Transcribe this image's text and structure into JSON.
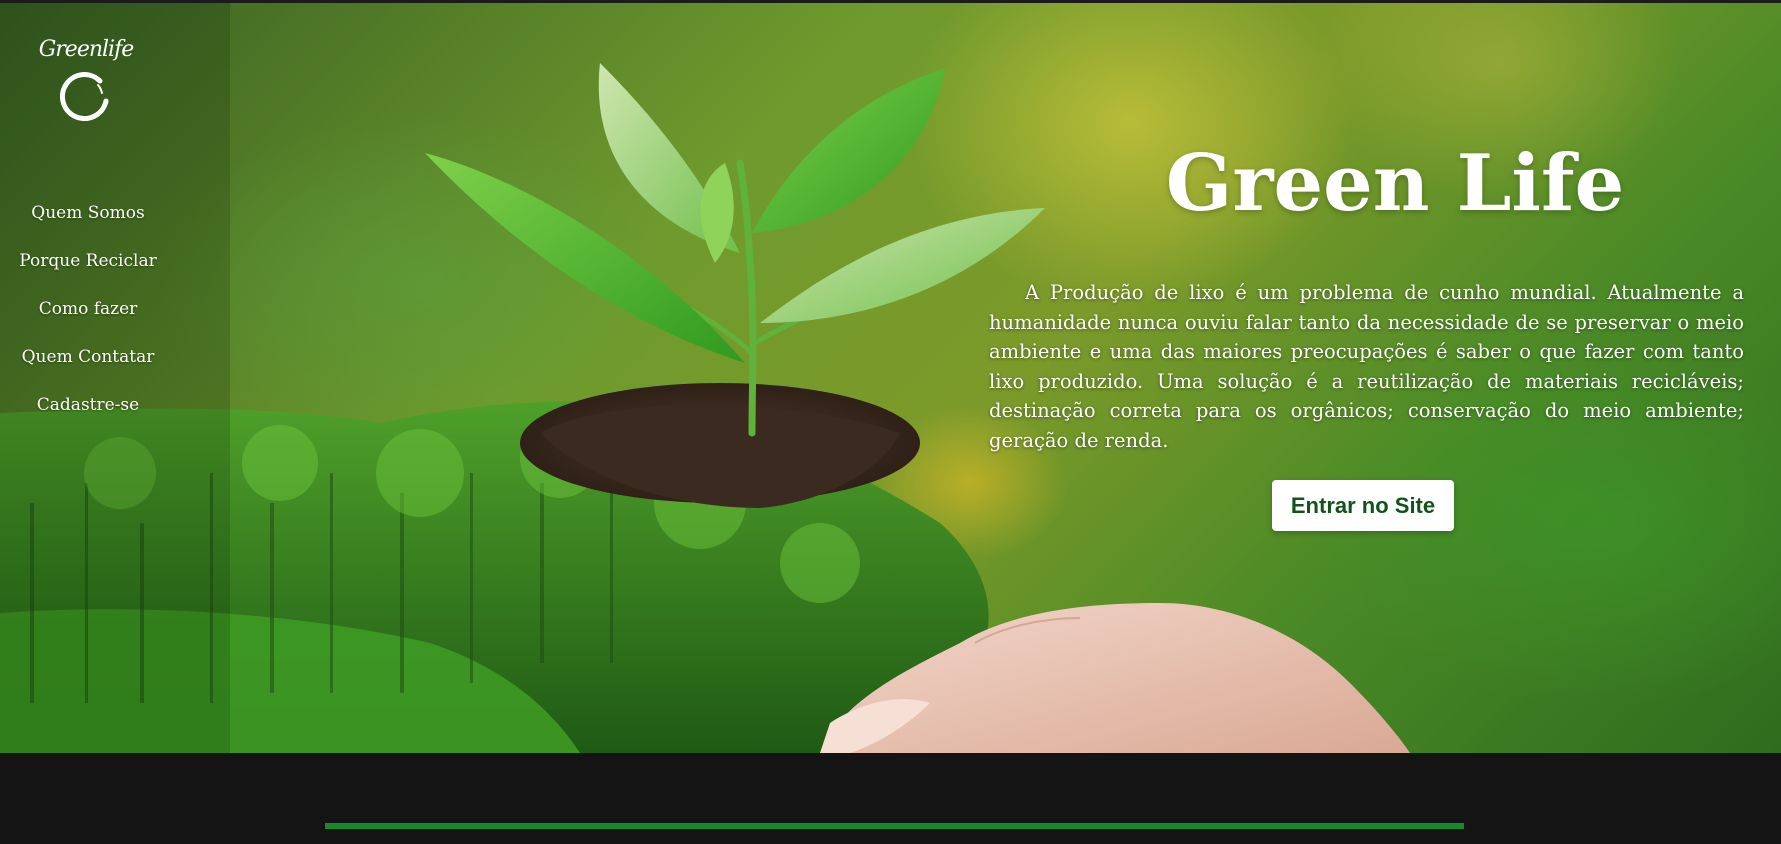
{
  "brand": {
    "logo_text": "Greenlife"
  },
  "nav": {
    "items": [
      {
        "label": "Quem Somos"
      },
      {
        "label": "Porque Reciclar"
      },
      {
        "label": "Como fazer"
      },
      {
        "label": "Quem Contatar"
      },
      {
        "label": "Cadastre-se"
      }
    ]
  },
  "hero": {
    "title": "Green Life",
    "paragraph": "A Produção de lixo é um problema de cunho mundial. Atualmente a humanidade nunca ouviu falar tanto da necessidade de se preservar o meio ambiente e uma das maiores preocupações é saber o que fazer com tanto lixo produzido. Uma solução é a reutilização de materiais recicláveis; destinação correta para os orgânicos; conservação do meio ambiente; geração de renda.",
    "cta_label": "Entrar no Site",
    "background_image": "seedling-in-forest-hands-photo"
  },
  "colors": {
    "cta_text": "#14521c",
    "footer_bg": "#141414",
    "footer_accent": "#168a2a"
  }
}
